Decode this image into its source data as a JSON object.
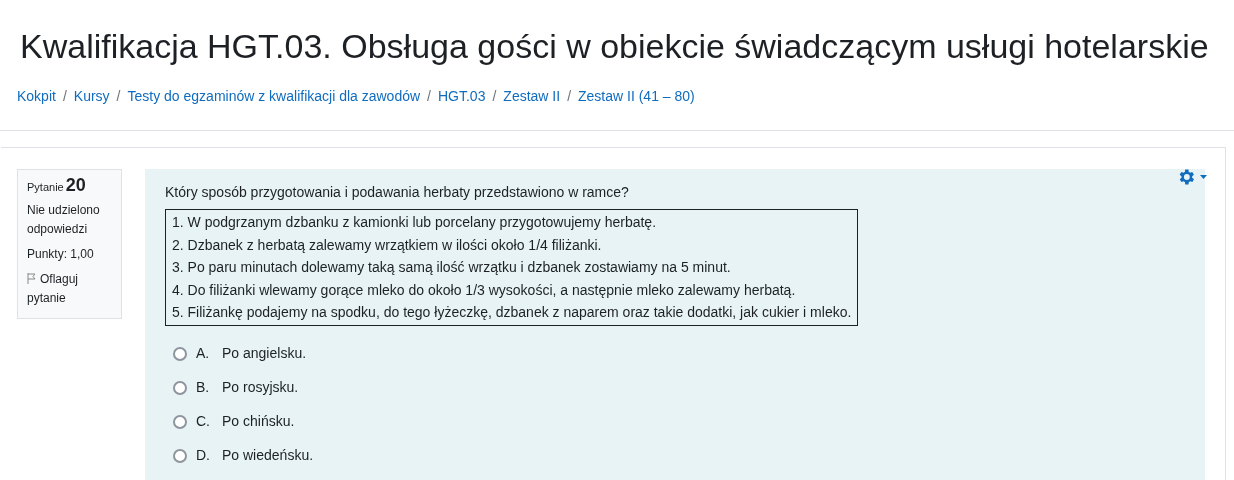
{
  "page_title": "Kwalifikacja HGT.03. Obsługa gości w obiekcie świadczącym usługi hotelarskie",
  "breadcrumbs": [
    {
      "label": "Kokpit"
    },
    {
      "separator": "/",
      "label": "Kursy"
    },
    {
      "separator": "/",
      "label": "Testy do egzaminów z kwalifikacji dla zawodów"
    },
    {
      "separator": "/",
      "label": "HGT.03"
    },
    {
      "separator": "/",
      "label": "Zestaw II"
    },
    {
      "separator": "/",
      "label": "Zestaw II (41 – 80)"
    }
  ],
  "question_info": {
    "label": "Pytanie",
    "number": "20",
    "status": "Nie udzielono odpowiedzi",
    "points": "Punkty: 1,00",
    "flag": "Oflaguj pytanie",
    "flagged": false
  },
  "question": {
    "text": "Który sposób przygotowania i podawania herbaty przedstawiono w ramce?",
    "steps": [
      "1. W podgrzanym dzbanku z kamionki lub porcelany przygotowujemy herbatę.",
      "2. Dzbanek z herbatą zalewamy wrzątkiem w ilości około 1/4 filiżanki.",
      "3. Po paru minutach dolewamy taką samą ilość wrzątku i dzbanek zostawiamy na 5 minut.",
      "4. Do filiżanki wlewamy gorące mleko do około 1/3 wysokości, a następnie mleko zalewamy herbatą.",
      "5. Filiżankę podajemy na spodku, do tego łyżeczkę, dzbanek z naparem oraz takie dodatki, jak cukier i mleko."
    ],
    "answers": [
      {
        "letter": "A.",
        "text": "Po angielsku.",
        "selected": false
      },
      {
        "letter": "B.",
        "text": "Po rosyjsku.",
        "selected": false
      },
      {
        "letter": "C.",
        "text": "Po chińsku.",
        "selected": false
      },
      {
        "letter": "D.",
        "text": "Po wiedeńsku.",
        "selected": false
      }
    ]
  }
}
